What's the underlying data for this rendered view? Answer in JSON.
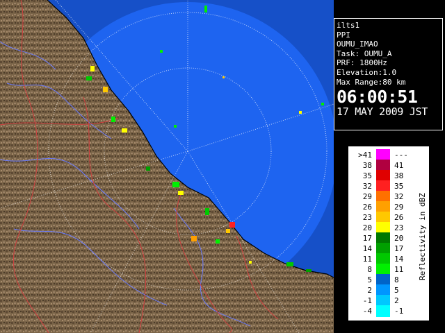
{
  "info": {
    "site": "ilts1",
    "product": "PPI",
    "radar_name": "OUMU_IMAO",
    "task": "Task: OUMU_A",
    "prf": "PRF: 1800Hz",
    "elevation": "Elevation:1.0",
    "max_range": "Max Range:80 km",
    "time": "06:00:51",
    "date": "17 MAY 2009 JST"
  },
  "legend": {
    "title": "Reflectivity in dBZ",
    "rows": [
      {
        "lo": ">41",
        "hi": "---",
        "color": "#ff00ff"
      },
      {
        "lo": "38",
        "hi": "41",
        "color": "#b00040"
      },
      {
        "lo": "35",
        "hi": "38",
        "color": "#e00000"
      },
      {
        "lo": "32",
        "hi": "35",
        "color": "#ff2020"
      },
      {
        "lo": "29",
        "hi": "32",
        "color": "#ff7000"
      },
      {
        "lo": "26",
        "hi": "29",
        "color": "#ffa000"
      },
      {
        "lo": "23",
        "hi": "26",
        "color": "#ffc800"
      },
      {
        "lo": "20",
        "hi": "23",
        "color": "#ffff00"
      },
      {
        "lo": "17",
        "hi": "20",
        "color": "#007800"
      },
      {
        "lo": "14",
        "hi": "17",
        "color": "#00a000"
      },
      {
        "lo": "11",
        "hi": "14",
        "color": "#00c800"
      },
      {
        "lo": "8",
        "hi": "11",
        "color": "#00f000"
      },
      {
        "lo": "5",
        "hi": "8",
        "color": "#0064c8"
      },
      {
        "lo": "2",
        "hi": "5",
        "color": "#0096ff"
      },
      {
        "lo": "-1",
        "hi": "2",
        "color": "#00c8ff"
      },
      {
        "lo": "-4",
        "hi": "-1",
        "color": "#00ffff"
      }
    ]
  },
  "map": {
    "sea_color": "#1e64f0",
    "sea_outer_color": "#1650c8",
    "land_color": "#7a6448"
  }
}
